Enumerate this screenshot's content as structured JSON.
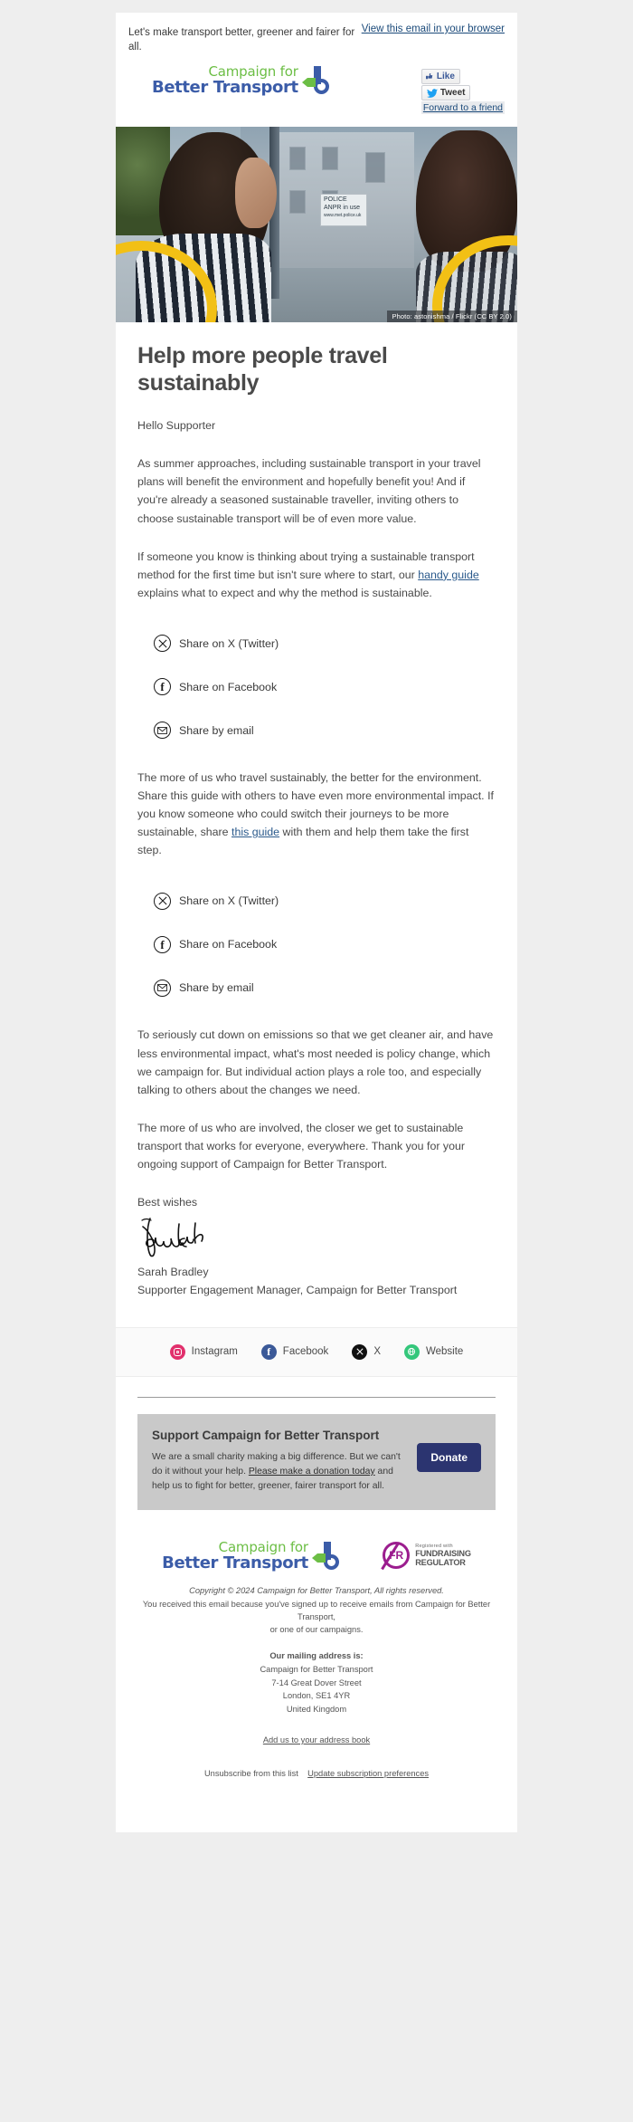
{
  "preheader": {
    "text": "Let's make transport better, greener and fairer for all.",
    "browser_link": "View this email in your browser"
  },
  "brand": {
    "line1": "Campaign for",
    "line2": "Better Transport",
    "green": "#6cbe45",
    "blue": "#3b5ca8"
  },
  "widgets": {
    "like": "Like",
    "tweet": "Tweet",
    "forward": "Forward to a friend"
  },
  "hero": {
    "credit": "Photo: astonishma / Flickr (CC BY 2.0)",
    "sign_line1": "POLICE",
    "sign_line2": "ANPR in use",
    "sign_line3": "www.met.police.uk"
  },
  "main": {
    "headline": "Help more people travel sustainably",
    "greeting": "Hello Supporter",
    "para1": "As summer approaches, including sustainable transport in your travel plans will benefit the environment and hopefully benefit you! And if you're already a seasoned sustainable traveller, inviting others to choose sustainable transport will be of even more value.",
    "para2_before": "If someone you know is thinking about trying a sustainable transport method for the first time but isn't sure where to start, our ",
    "para2_link": "handy guide",
    "para2_after": " explains what to expect and why the method is sustainable.",
    "para3_before": "The more of us who travel sustainably, the better for the environment. Share this guide with others to have even more environmental impact. If you know someone who could switch their journeys to be more sustainable, share ",
    "para3_link": "this guide",
    "para3_after": " with them and help them take the first step.",
    "para4": "To seriously cut down on emissions so that we get cleaner air, and have less environmental impact, what's most needed is policy change, which we campaign for. But individual action plays a role too, and especially talking to others about the changes we need.",
    "para5": "The more of us who are involved, the closer we get to sustainable transport that works for everyone, everywhere. Thank you for your ongoing support of Campaign for Better Transport.",
    "best_wishes": "Best wishes",
    "signer_name": "Sarah Bradley",
    "signer_title": "Supporter Engagement Manager, Campaign for Better Transport"
  },
  "share": {
    "x": "Share on X (Twitter)",
    "facebook": "Share on Facebook",
    "email": "Share by email"
  },
  "social": [
    {
      "label": "Instagram",
      "icon": "instagram-icon",
      "color": "#e1306c"
    },
    {
      "label": "Facebook",
      "icon": "facebook-icon",
      "color": "#3b5998"
    },
    {
      "label": "X",
      "icon": "x-icon",
      "color": "#111111"
    },
    {
      "label": "Website",
      "icon": "globe-icon",
      "color": "#34c77b"
    }
  ],
  "support": {
    "title": "Support Campaign for Better Transport",
    "copy_before": "We are a small charity making a big difference. But we can't do it without your help. ",
    "copy_link": "Please make a donation today",
    "copy_after": " and help us to fight for better, greener, fairer transport for all.",
    "donate_label": "Donate",
    "donate_color": "#2b3470"
  },
  "regulator": {
    "badge": "FR",
    "line1": "Registered with",
    "line2": "FUNDRAISING",
    "line3": "REGULATOR",
    "color": "#9b1d8e"
  },
  "footer": {
    "copyright": "Copyright © 2024 Campaign for Better Transport, All rights reserved.",
    "reason_line1": "You received this email because you've signed up to receive emails from Campaign for Better Transport,",
    "reason_line2": "or one of our campaigns.",
    "address_heading": "Our mailing address is:",
    "address_line1": "Campaign for Better Transport",
    "address_line2": "7-14 Great Dover Street",
    "address_line3": "London, SE1 4YR",
    "address_line4": "United Kingdom",
    "address_book_link": "Add us to your address book",
    "unsubscribe": "Unsubscribe from this list",
    "update_prefs": "Update subscription preferences"
  }
}
